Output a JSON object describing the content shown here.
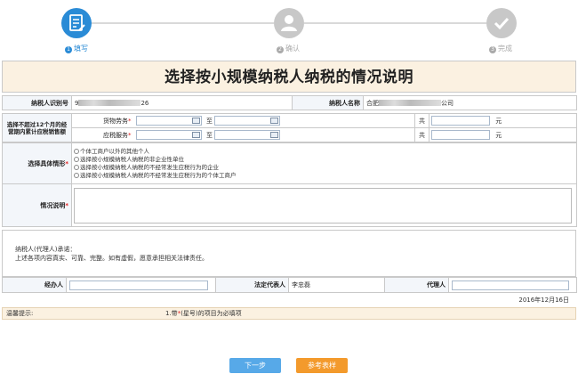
{
  "steps": [
    {
      "num": "1",
      "label": "填写",
      "active": true
    },
    {
      "num": "2",
      "label": "确认",
      "active": false
    },
    {
      "num": "3",
      "label": "完成",
      "active": false
    }
  ],
  "form": {
    "title": "选择按小规模纳税人纳税的情况说明",
    "taxpayer_id_label": "纳税人识别号",
    "taxpayer_id_value_suffix": "26",
    "taxpayer_id_value_prefix": "9",
    "taxpayer_name_label": "纳税人名称",
    "taxpayer_name_prefix": "合肥",
    "taxpayer_name_suffix": "公司",
    "period_label": "选择不超过12个月的经营期内累计应税销售额",
    "goods_label": "货物劳务",
    "services_label": "应税服务",
    "to_label": "至",
    "total_label": "共",
    "unit_label": "元",
    "situation_label": "选择具体情形",
    "situation_options": [
      "个体工商户以外的其他个人",
      "选择按小规模纳税人纳税的非企业性单位",
      "选择按小规模纳税人纳税的不经常发生应税行为的企业",
      "选择按小规模纳税人纳税的不经常发生应税行为的个体工商户"
    ],
    "description_label": "情况说明",
    "promise_line1": "纳税人(代理人)承诺：",
    "promise_line2": "上述各项内容真实、可靠、完整。如有虚假，愿意承担相关法律责任。",
    "handler_label": "经办人",
    "legal_rep_label": "法定代表人",
    "legal_rep_value": "李忠磊",
    "agent_label": "代理人",
    "date": "2016年12月16日",
    "tips_label": "温馨提示:",
    "tips_text_prefix": "1.带",
    "tips_text_star": "*",
    "tips_text_suffix": "(星号)的项目为必填项"
  },
  "buttons": {
    "next": "下一步",
    "sample": "参考表样"
  },
  "colors": {
    "active_step": "#2a8bd6",
    "inactive_step": "#c8c8c8",
    "title_bg": "#fbf1e1",
    "required": "#e02020",
    "next_button": "#57a9e8",
    "sample_button": "#f39a2c"
  }
}
